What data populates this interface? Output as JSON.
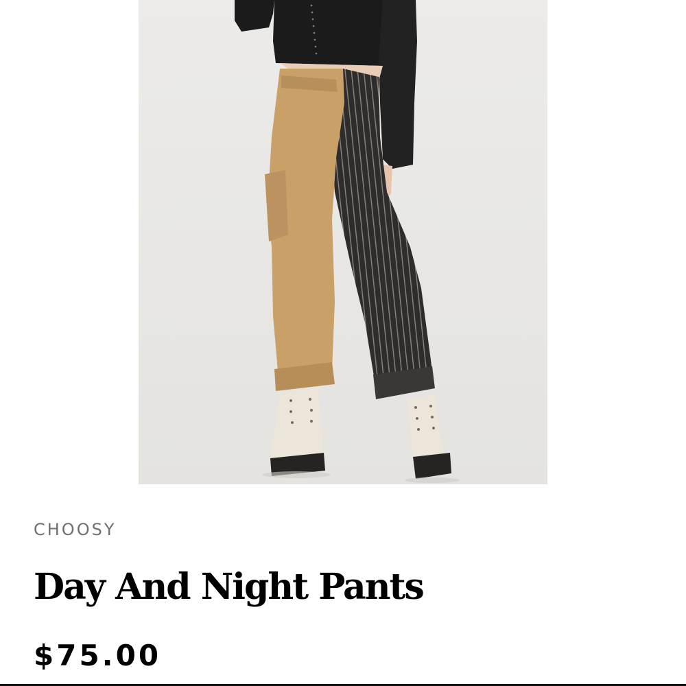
{
  "product": {
    "image_subject": "Day and Night Pants product photo",
    "brand": "CHOOSY",
    "title": "Day And Night Pants",
    "price": "$75.00"
  },
  "colors": {
    "photo_background": "#e9e8e6",
    "tan_leg": "#c9a068",
    "pinstripe_leg": "#2f2d2b",
    "top": "#1c1b1c",
    "boots": "#ece6da",
    "brand_text": "#707070",
    "title_text": "#000000"
  }
}
